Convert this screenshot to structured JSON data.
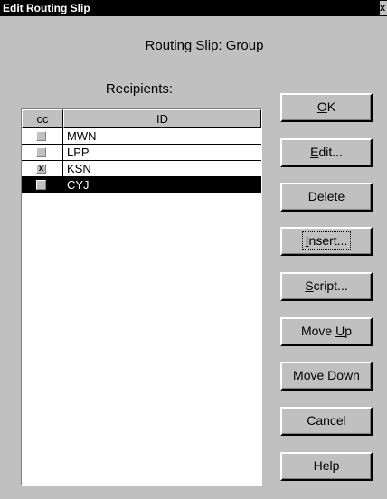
{
  "window": {
    "title": "Edit Routing Slip",
    "close_glyph": "x"
  },
  "header": {
    "subtitle": "Routing Slip: Group",
    "recipients_label": "Recipients:"
  },
  "table": {
    "columns": [
      "cc",
      "ID"
    ],
    "rows": [
      {
        "cc_checked": false,
        "cc_mark": "",
        "id": "MWN"
      },
      {
        "cc_checked": false,
        "cc_mark": "",
        "id": "LPP"
      },
      {
        "cc_checked": true,
        "cc_mark": "x",
        "id": "KSN"
      },
      {
        "cc_checked": false,
        "cc_mark": "",
        "id": "CYJ",
        "selected": true
      }
    ]
  },
  "buttons": {
    "ok": {
      "pre": "",
      "key": "O",
      "post": "K"
    },
    "edit": {
      "pre": "",
      "key": "E",
      "post": "dit..."
    },
    "delete": {
      "pre": "",
      "key": "D",
      "post": "elete"
    },
    "insert": {
      "pre": "",
      "key": "I",
      "post": "nsert..."
    },
    "script": {
      "pre": "",
      "key": "S",
      "post": "cript..."
    },
    "move_up": {
      "pre": "Move ",
      "key": "U",
      "post": "p"
    },
    "move_down": {
      "pre": "Move Dow",
      "key": "n",
      "post": ""
    },
    "cancel": {
      "pre": "Cancel",
      "key": "",
      "post": ""
    },
    "help": {
      "pre": "Help",
      "key": "",
      "post": ""
    }
  },
  "colors": {
    "dialog_bg": "#c0c0c0",
    "titlebar": "#000000",
    "selection": "#000000"
  }
}
